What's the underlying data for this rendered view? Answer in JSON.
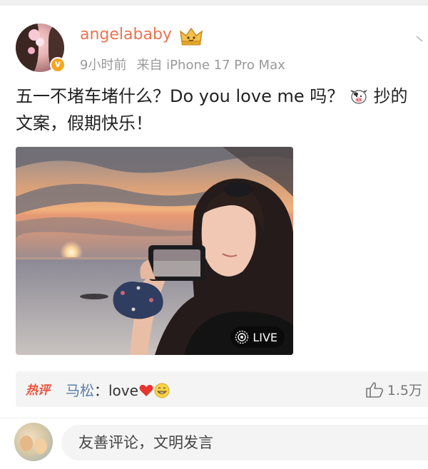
{
  "post": {
    "username": "angelababy",
    "time": "9小时前",
    "source": "来自 iPhone 17 Pro Max",
    "text_part1": "五一不堵车堵什么？Do you love me 吗？",
    "text_part2": "抄的文案，假期快乐！",
    "photo": {
      "live_label": "LIVE"
    }
  },
  "hot_comment": {
    "tag": "热评",
    "author": "马松",
    "separator": "：",
    "text": "love",
    "likes": "1.5万"
  },
  "comment_bar": {
    "placeholder": "友善评论，文明发言"
  },
  "colors": {
    "username": "#eb7350",
    "hot_tag": "#e8543c",
    "author": "#5a7ea8"
  },
  "icons": [
    "crown-badge-icon",
    "verified-badge-icon",
    "chevron-icon",
    "cow-emoji-icon",
    "live-photo-icon",
    "heart-emoji-icon",
    "grin-emoji-icon",
    "thumbs-up-icon"
  ]
}
